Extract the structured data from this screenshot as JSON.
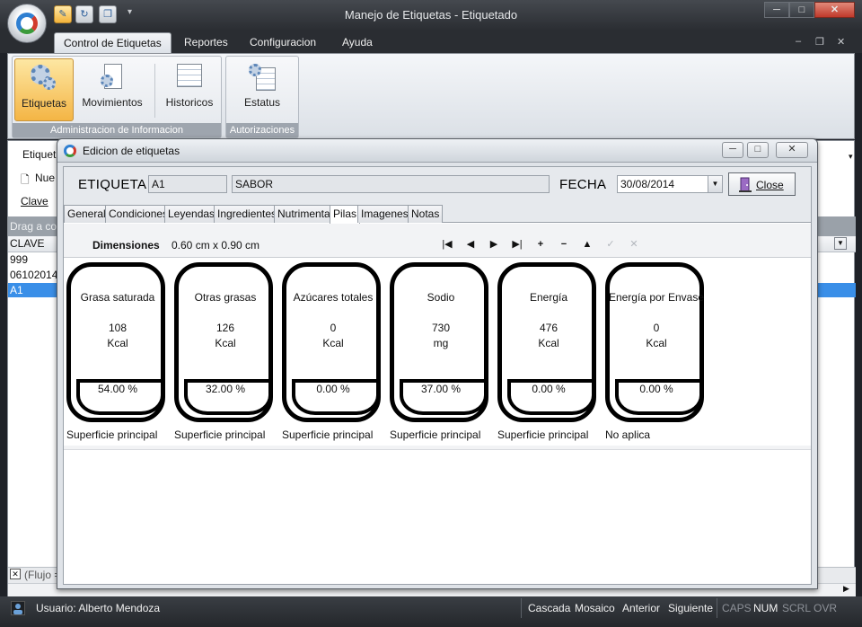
{
  "app": {
    "title": "Manejo de Etiquetas - Etiquetado",
    "menu_tabs": [
      "Control de Etiquetas",
      "Reportes",
      "Configuracion",
      "Ayuda"
    ],
    "window_controls": {
      "minimize": "─",
      "maximize": "□",
      "close": "✕"
    },
    "mdi_controls": {
      "minimize": "–",
      "restore": "❐",
      "close": "✕"
    }
  },
  "ribbon": {
    "groups": [
      {
        "label": "Administracion de Informacion",
        "buttons": [
          "Etiquetas",
          "Movimientos",
          "Historicos"
        ]
      },
      {
        "label": "Autorizaciones",
        "buttons": [
          "Estatus"
        ]
      }
    ]
  },
  "background": {
    "toolbar_label": "Etiquet",
    "new_button": "Nue",
    "search_label": "Clave",
    "drag_hint": "Drag a colu",
    "column_header": "CLAVE",
    "rows": [
      "999",
      "06102014",
      "A1"
    ],
    "footer": "(Flujo ="
  },
  "dialog": {
    "title": "Edicion de etiquetas",
    "controls": {
      "minimize": "─",
      "maximize": "□",
      "close": "✕"
    },
    "etiqueta_label": "ETIQUETA",
    "etiqueta_value": "A1",
    "sabor_value": "SABOR",
    "fecha_label": "FECHA",
    "fecha_value": "30/08/2014",
    "close_button": "Close",
    "tabs": [
      "General",
      "Condiciones",
      "Leyendas",
      "Ingredientes",
      "Nutrimental",
      "Pilas",
      "Imagenes",
      "Notas"
    ],
    "active_tab": "Pilas",
    "dimensions_label": "Dimensiones",
    "dimensions_value": "0.60 cm x 0.90 cm",
    "navigator": [
      "|◀",
      "◀",
      "▶",
      "▶|",
      "+",
      "−",
      "▲",
      "✓",
      "✕"
    ],
    "cards": [
      {
        "name": "Grasa saturada",
        "value": "108",
        "unit": "Kcal",
        "percent": "54.00 %",
        "surface": "Superficie principal"
      },
      {
        "name": "Otras grasas",
        "value": "126",
        "unit": "Kcal",
        "percent": "32.00 %",
        "surface": "Superficie principal"
      },
      {
        "name": "Azúcares totales",
        "value": "0",
        "unit": "Kcal",
        "percent": "0.00 %",
        "surface": "Superficie principal"
      },
      {
        "name": "Sodio",
        "value": "730",
        "unit": "mg",
        "percent": "37.00 %",
        "surface": "Superficie principal"
      },
      {
        "name": "Energía",
        "value": "476",
        "unit": "Kcal",
        "percent": "0.00 %",
        "surface": "Superficie principal"
      },
      {
        "name": "Energía por Envase",
        "value": "0",
        "unit": "Kcal",
        "percent": "0.00 %",
        "surface": "No aplica"
      }
    ]
  },
  "statusbar": {
    "user": "Usuario: Alberto Mendoza",
    "cascada": "Cascada",
    "mosaico": "Mosaico",
    "anterior": "Anterior",
    "siguiente": "Siguiente",
    "caps": "CAPS",
    "num": "NUM",
    "scrl": "SCRL",
    "ovr": "OVR"
  }
}
